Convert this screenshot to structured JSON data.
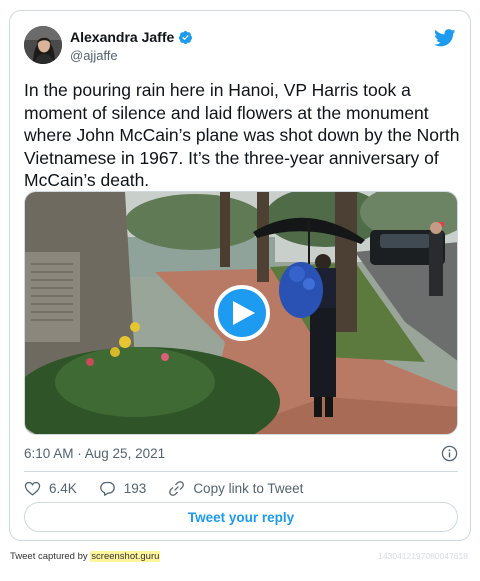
{
  "author": {
    "display_name": "Alexandra Jaffe",
    "handle": "@ajjaffe",
    "verified": true
  },
  "tweet": {
    "text": "In the pouring rain here in Hanoi, VP Harris took a moment of silence and laid flowers at the monument where John McCain’s plane was shot down by the North Vietnamese in 1967. It’s the three-year anniversary of McCain’s death.",
    "timestamp": "6:10 AM · Aug 25, 2021"
  },
  "media": {
    "type": "video",
    "icon": "play-icon"
  },
  "actions": {
    "likes": "6.4K",
    "replies": "193",
    "copy_link": "Copy link to Tweet"
  },
  "reply_button": "Tweet your reply",
  "footer": {
    "captured_by": "Tweet captured by ",
    "brand": "screenshot.guru",
    "tweet_id": "1430412197080047618"
  },
  "colors": {
    "accent": "#1d9bf0",
    "text": "#0f1419",
    "muted": "#536471",
    "border": "#cfd9de"
  }
}
